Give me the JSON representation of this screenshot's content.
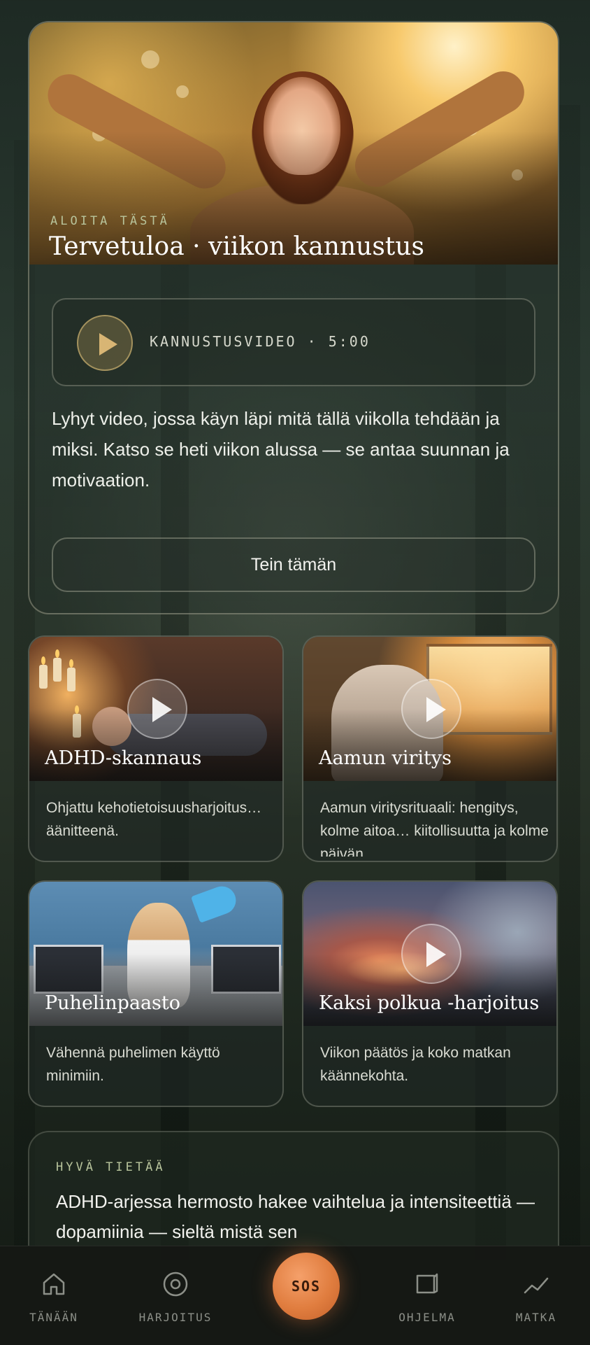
{
  "hero": {
    "eyebrow": "ALOITA TÄSTÄ",
    "title": "Tervetuloa · viikon kannustus",
    "video_label": "KANNUSTUSVIDEO · 5:00",
    "description": "Lyhyt video, jossa käyn läpi mitä tällä viikolla tehdään ja miksi. Katso se heti viikon alussa — se antaa suunnan ja motivaation.",
    "done_label": "Tein tämän"
  },
  "exercises": [
    {
      "title": "ADHD-skannaus",
      "description": "Ohjattu kehotietoisuusharjoitus… äänitteenä."
    },
    {
      "title": "Aamun viritys",
      "description": "Aamun viritysrituaali: hengitys, kolme aitoa… kiitollisuutta ja kolme päivän"
    },
    {
      "title": "Puhelinpaasto",
      "description": "Vähennä puhelimen käyttö minimiin."
    },
    {
      "title": "Kaksi polkua -harjoitus",
      "description": "Viikon päätös ja koko matkan käännekohta."
    }
  ],
  "info": {
    "eyebrow": "HYVÄ TIETÄÄ",
    "text": "ADHD-arjessa hermosto hakee vaihtelua ja intensiteettiä — dopamiinia — sieltä mistä sen"
  },
  "nav": {
    "items": [
      {
        "label": "TÄNÄÄN",
        "icon": "home-icon"
      },
      {
        "label": "HARJOITUS",
        "icon": "target-icon"
      },
      {
        "label": "OHJELMA",
        "icon": "book-icon"
      },
      {
        "label": "MATKA",
        "icon": "trend-icon"
      }
    ],
    "sos_label": "SOS"
  },
  "colors": {
    "accent": "#e07d3f",
    "eyebrow": "#b8c49c",
    "nav_inactive": "#8c8f88"
  }
}
